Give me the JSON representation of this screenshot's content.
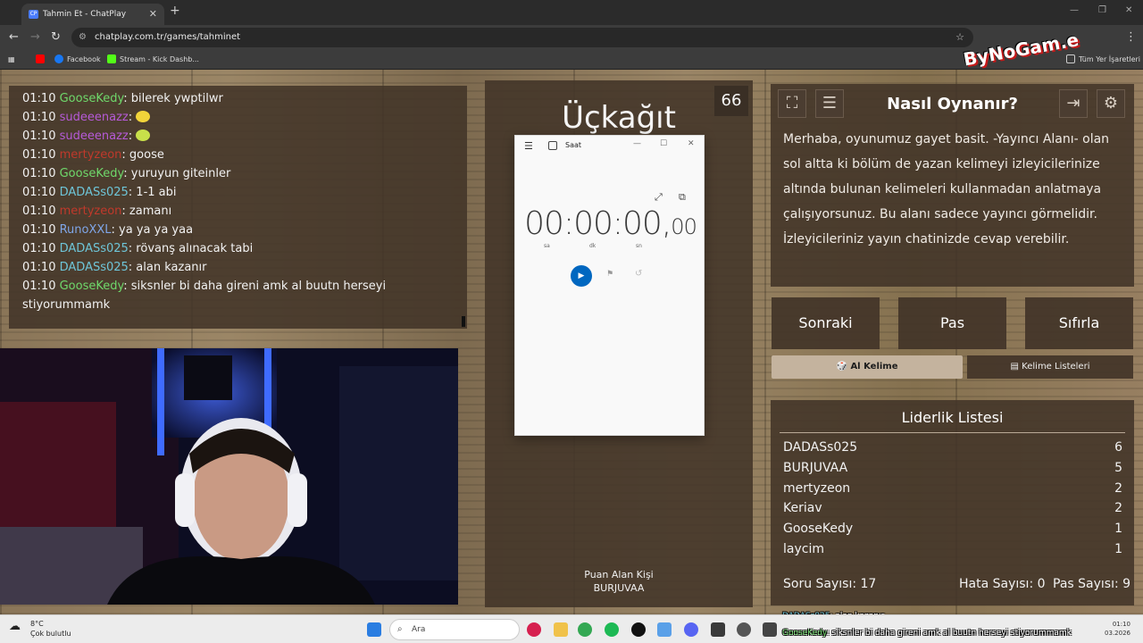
{
  "browser": {
    "tab_title": "Tahmin Et - ChatPlay",
    "favicon_text": "CP",
    "url": "chatplay.com.tr/games/tahminet",
    "bookmarks": [
      {
        "label": "",
        "color": "#ff0000"
      },
      {
        "label": "Facebook",
        "color": "#1877f2"
      },
      {
        "label": "Stream - Kick Dashb...",
        "color": "#53fc18"
      }
    ],
    "all_bookmarks": "Tüm Yer İşaretleri"
  },
  "overlay_logo": "ByNoGam.e",
  "chat": {
    "lines": [
      {
        "time": "01:10",
        "user": "GooseKedy",
        "color": "#6fd96b",
        "msg": ": bilerek ywptilwr",
        "emote": ""
      },
      {
        "time": "01:10",
        "user": "sudeeenazz",
        "color": "#b65ad8",
        "msg": ": ",
        "emote": "#f2d43a"
      },
      {
        "time": "01:10",
        "user": "sudeeenazz",
        "color": "#b65ad8",
        "msg": ": ",
        "emote": "#c8e04a"
      },
      {
        "time": "01:10",
        "user": "mertyzeon",
        "color": "#c0392b",
        "msg": ": goose",
        "emote": ""
      },
      {
        "time": "01:10",
        "user": "GooseKedy",
        "color": "#6fd96b",
        "msg": ": yuruyun giteinler",
        "emote": ""
      },
      {
        "time": "01:10",
        "user": "DADASs025",
        "color": "#6ec5d8",
        "msg": ": 1-1 abi",
        "emote": ""
      },
      {
        "time": "01:10",
        "user": "mertyzeon",
        "color": "#c0392b",
        "msg": ": zamanı",
        "emote": ""
      },
      {
        "time": "01:10",
        "user": "RunoXXL",
        "color": "#7fa6e8",
        "msg": ": ya ya ya yaa",
        "emote": ""
      },
      {
        "time": "01:10",
        "user": "DADASs025",
        "color": "#6ec5d8",
        "msg": ": rövanş alınacak tabi",
        "emote": ""
      },
      {
        "time": "01:10",
        "user": "DADASs025",
        "color": "#6ec5d8",
        "msg": ": alan kazanır",
        "emote": ""
      }
    ],
    "last": {
      "time": "01:10",
      "user": "GooseKedy",
      "color": "#6fd96b",
      "msg": ": siksnler bi daha gireni amk al buutn herseyi stiyorummamk"
    }
  },
  "game": {
    "word": "Üçkağıt",
    "counter": "66",
    "scorer_label": "Puan Alan Kişi",
    "scorer_name": "BURJUVAA"
  },
  "clock_app": {
    "title": "Saat",
    "time_main": "00:00:00,",
    "time_frac": "00",
    "units": [
      "sa",
      "dk",
      "sn"
    ]
  },
  "info": {
    "title": "Nasıl Oynanır?",
    "text": "Merhaba, oyunumuz gayet basit. -Yayıncı Alanı- olan sol altta ki bölüm de yazan kelimeyi izleyicilerinize altında bulunan kelimeleri kullanmadan anlatmaya çalışıyorsunuz. Bu alanı sadece yayıncı görmelidir. İzleyicileriniz yayın chatinizde cevap verebilir."
  },
  "controls": {
    "next": "Sonraki",
    "pass": "Pas",
    "reset": "Sıfırla",
    "tab_get_word": "Al Kelime",
    "tab_word_lists": "Kelime Listeleri"
  },
  "leaderboard": {
    "title": "Liderlik Listesi",
    "rows": [
      {
        "name": "DADASs025",
        "score": "6"
      },
      {
        "name": "BURJUVAA",
        "score": "5"
      },
      {
        "name": "mertyzeon",
        "score": "2"
      },
      {
        "name": "Keriav",
        "score": "2"
      },
      {
        "name": "GooseKedy",
        "score": "1"
      },
      {
        "name": "laycim",
        "score": "1"
      }
    ],
    "question_count": "Soru Sayısı: 17",
    "error_count": "Hata Sayısı: 0",
    "pass_count": "Pas Sayısı: 9"
  },
  "taskbar": {
    "weather_temp": "8°C",
    "weather_desc": "Çok bulutlu",
    "search": "Ara",
    "time": "01:10",
    "date": "03.2026"
  },
  "overlay_chat": [
    {
      "user": "DADASs025",
      "color": "#6ec5d8",
      "msg": ": alan kazanır"
    },
    {
      "user": "GooseKedy",
      "color": "#6fd96b",
      "msg": ": siksnler bi daha gireni amk al buutn herseyi stiyorummamk"
    }
  ]
}
